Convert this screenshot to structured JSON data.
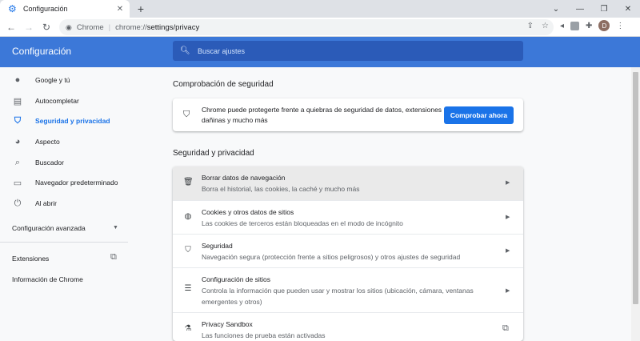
{
  "browser": {
    "tab_title": "Configuración",
    "tab_icon": "gear-icon",
    "close_glyph": "✕",
    "new_tab_glyph": "+",
    "minimize_glyph": "—",
    "restore_glyph": "❐",
    "window_close_glyph": "✕",
    "back_glyph": "←",
    "forward_glyph": "→",
    "reload_glyph": "↻",
    "site_label": "Chrome",
    "url_prefix": "chrome://",
    "url_path": "settings/privacy",
    "avatar_letter": "D"
  },
  "header": {
    "title": "Configuración",
    "search_placeholder": "Buscar ajustes"
  },
  "sidebar": {
    "items": [
      {
        "label": "Google y tú",
        "icon": "person-icon"
      },
      {
        "label": "Autocompletar",
        "icon": "clipboard-icon"
      },
      {
        "label": "Seguridad y privacidad",
        "icon": "shield-icon"
      },
      {
        "label": "Aspecto",
        "icon": "palette-icon"
      },
      {
        "label": "Buscador",
        "icon": "search-icon"
      },
      {
        "label": "Navegador predeterminado",
        "icon": "browser-icon"
      },
      {
        "label": "Al abrir",
        "icon": "power-icon"
      }
    ],
    "advanced": "Configuración avanzada",
    "extensions": "Extensiones",
    "about": "Información de Chrome"
  },
  "safety_check": {
    "section_title": "Comprobación de seguridad",
    "text": "Chrome puede protegerte frente a quiebras de seguridad de datos, extensiones dañinas y mucho más",
    "button": "Comprobar ahora"
  },
  "privacy": {
    "section_title": "Seguridad y privacidad",
    "rows": [
      {
        "title": "Borrar datos de navegación",
        "subtitle": "Borra el historial, las cookies, la caché y mucho más",
        "icon": "trash-icon"
      },
      {
        "title": "Cookies y otros datos de sitios",
        "subtitle": "Las cookies de terceros están bloqueadas en el modo de incógnito",
        "icon": "cookie-icon"
      },
      {
        "title": "Seguridad",
        "subtitle": "Navegación segura (protección frente a sitios peligrosos) y otros ajustes de seguridad",
        "icon": "shield-icon"
      },
      {
        "title": "Configuración de sitios",
        "subtitle": "Controla la información que pueden usar y mostrar los sitios (ubicación, cámara, ventanas emergentes y otros)",
        "icon": "sliders-icon"
      },
      {
        "title": "Privacy Sandbox",
        "subtitle": "Las funciones de prueba están activadas",
        "icon": "flask-icon"
      }
    ]
  },
  "colors": {
    "accent": "#1a73e8",
    "appbar": "#3c78d8"
  }
}
